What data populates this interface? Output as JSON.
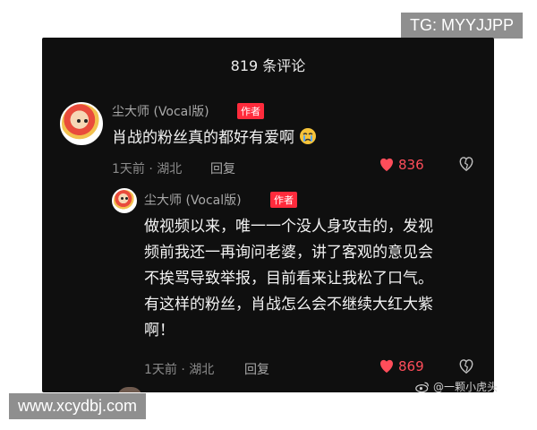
{
  "overlay": {
    "tg_badge": "TG: MYYJJPP",
    "site_watermark": "www.xcydbj.com",
    "weibo_watermark": "@一颗小虎头"
  },
  "header": {
    "comment_count_title": "819 条评论"
  },
  "comments": [
    {
      "author": "尘大师 (Vocal版)",
      "tag": "作者",
      "text": "肖战的粉丝真的都好有爱啊",
      "emoji": "crying-face",
      "meta": "1天前 · 湖北",
      "reply_label": "回复",
      "likes": "836"
    },
    {
      "author": "尘大师 (Vocal版)",
      "tag": "作者",
      "lines": [
        "做视频以来，唯一一个没人身攻击的，发视",
        "频前我还一再询问老婆，讲了客观的意见会",
        "不挨骂导致举报，目前看来让我松了口气。",
        "有这样的粉丝，肖战怎么会不继续大红大紫",
        "啊！"
      ],
      "meta": "1天前 · 湖北",
      "reply_label": "回复",
      "likes": "869"
    }
  ],
  "colors": {
    "panel_bg": "#0f0f0f",
    "tag_red": "#ff2b3c",
    "like_red": "#ff4d5a"
  }
}
